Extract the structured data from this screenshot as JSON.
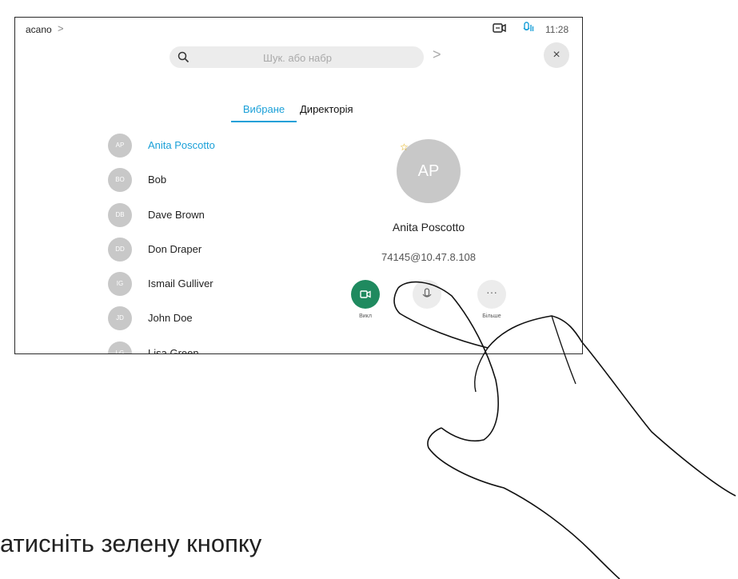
{
  "topbar": {
    "title": "acano",
    "time": "11:28",
    "chevron": ">"
  },
  "search": {
    "placeholder": "Шук. або набр",
    "go": ">",
    "close": "×"
  },
  "tabs": {
    "favorites": "Вибране",
    "directory": "Директорія"
  },
  "contacts": [
    {
      "initials": "AP",
      "name": "Anita Poscotto",
      "selected": true
    },
    {
      "initials": "BO",
      "name": "Bob"
    },
    {
      "initials": "DB",
      "name": "Dave Brown"
    },
    {
      "initials": "DD",
      "name": "Don Draper"
    },
    {
      "initials": "IG",
      "name": "Ismail Gulliver"
    },
    {
      "initials": "JD",
      "name": "John Doe"
    },
    {
      "initials": "LG",
      "name": "Lisa Green"
    }
  ],
  "detail": {
    "initials": "AP",
    "name": "Anita Poscotto",
    "address": "74145@10.47.8.108",
    "favorite_icon": "star-icon"
  },
  "actions": {
    "call": "Викл",
    "more": "Більше",
    "more_glyph": "···"
  },
  "caption": "атисніть зелену кнопку",
  "colors": {
    "accent": "#1ba0d8",
    "call": "#1f8a5f",
    "avatar": "#c8c8c8"
  }
}
